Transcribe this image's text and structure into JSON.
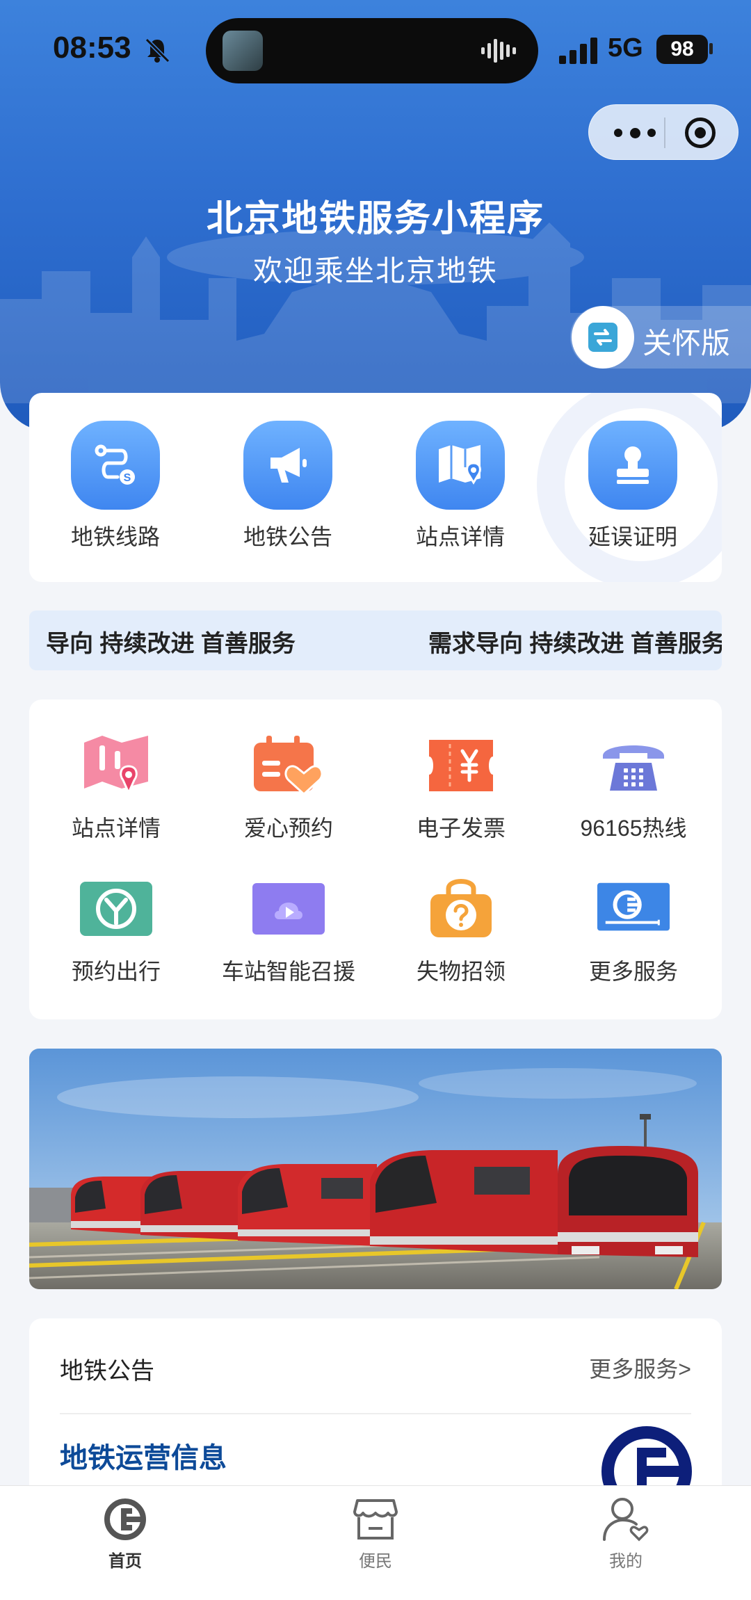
{
  "status_bar": {
    "time": "08:53",
    "network": "5G",
    "battery": "98"
  },
  "header": {
    "title": "北京地铁服务小程序",
    "subtitle": "欢迎乘坐北京地铁",
    "care_mode_label": "关怀版"
  },
  "quick_actions": [
    {
      "label": "地铁线路",
      "icon": "route-icon"
    },
    {
      "label": "地铁公告",
      "icon": "megaphone-icon"
    },
    {
      "label": "站点详情",
      "icon": "map-pin-icon"
    },
    {
      "label": "延误证明",
      "icon": "stamp-icon"
    }
  ],
  "marquee": {
    "segment_1": "导向 持续改进 首善服务",
    "segment_2": "需求导向 持续改进 首善服务"
  },
  "services": [
    {
      "label": "站点详情",
      "icon": "map-pin-icon",
      "color": "#f06a8a"
    },
    {
      "label": "爱心预约",
      "icon": "calendar-heart-icon",
      "color": "#f5754a"
    },
    {
      "label": "电子发票",
      "icon": "ticket-yen-icon",
      "color": "#f5663f"
    },
    {
      "label": "96165热线",
      "icon": "telephone-icon",
      "color": "#7b86e0"
    },
    {
      "label": "预约出行",
      "icon": "clock-pass-icon",
      "color": "#4fb39a"
    },
    {
      "label": "车站智能召援",
      "icon": "video-call-icon",
      "color": "#8e7cf0"
    },
    {
      "label": "失物招领",
      "icon": "lost-bag-icon",
      "color": "#f5a33a"
    },
    {
      "label": "更多服务",
      "icon": "subway-logo-icon",
      "color": "#3d86e6"
    }
  ],
  "notices": {
    "title": "地铁公告",
    "more_label": "更多服务>",
    "first_item": "地铁运营信息"
  },
  "tab_bar": [
    {
      "label": "首页",
      "icon": "subway-logo-icon",
      "active": true
    },
    {
      "label": "便民",
      "icon": "store-icon",
      "active": false
    },
    {
      "label": "我的",
      "icon": "user-heart-icon",
      "active": false
    }
  ],
  "colors": {
    "header_blue": "#2f6fd0",
    "accent_blue": "#3f86f0",
    "notice_blue": "#0d4a98"
  }
}
